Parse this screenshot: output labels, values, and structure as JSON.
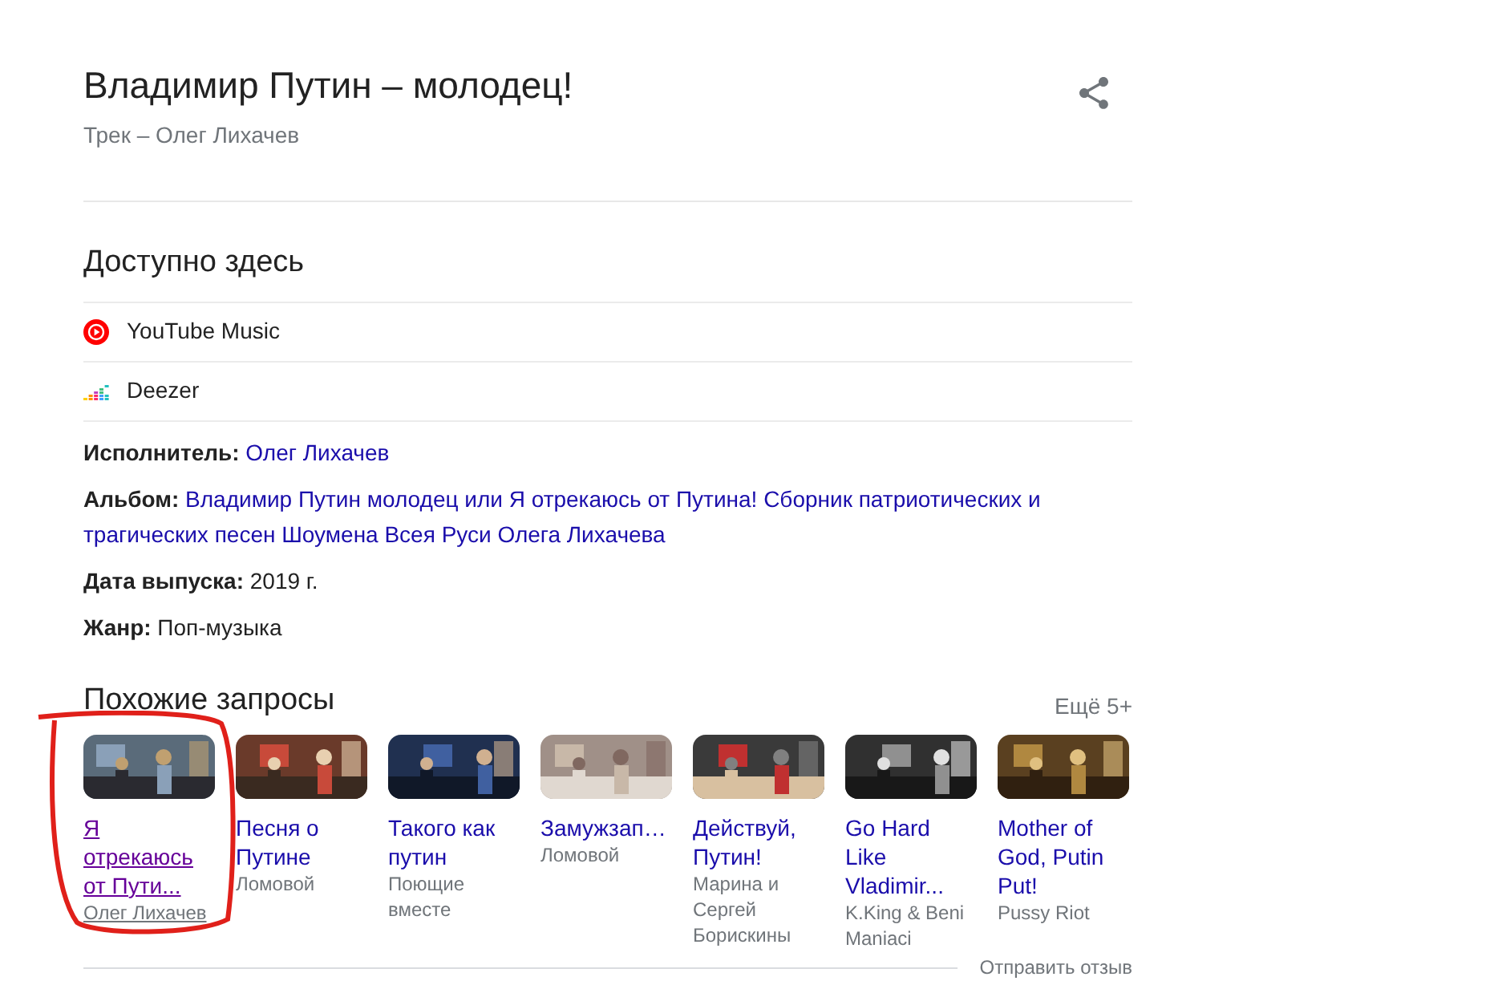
{
  "header": {
    "title": "Владимир Путин – молодец!",
    "subtitle": "Трек – Олег Лихачев"
  },
  "available": {
    "heading": "Доступно здесь",
    "services": [
      {
        "name": "YouTube Music",
        "kind": "youtube"
      },
      {
        "name": "Deezer",
        "kind": "deezer"
      }
    ]
  },
  "facts": [
    {
      "label": "Исполнитель:",
      "value": "Олег Лихачев",
      "kind": "link"
    },
    {
      "label": "Альбом:",
      "value": "Владимир Путин молодец или Я отрекаюсь от Путина! Сборник патриотических и трагических песен Шоумена Всея Руси Олега Лихачева",
      "kind": "link"
    },
    {
      "label": "Дата выпуска:",
      "value": "2019 г.",
      "kind": "plain"
    },
    {
      "label": "Жанр:",
      "value": "Поп-музыка",
      "kind": "plain"
    }
  ],
  "related": {
    "heading": "Похожие запросы",
    "more": "Ещё 5+",
    "items": [
      {
        "title": "Я отрекаюсь от Пути...",
        "subtitle": "Олег Лихачев",
        "highlighted": true
      },
      {
        "title": "Песня о Путине",
        "subtitle": "Ломовой",
        "highlighted": false
      },
      {
        "title": "Такого как путин",
        "subtitle": "Поющие вместе",
        "highlighted": false
      },
      {
        "title": "Замужзап…",
        "subtitle": "Ломовой",
        "highlighted": false
      },
      {
        "title": "Действуй, Путин!",
        "subtitle": "Марина и Сергей Борискины",
        "highlighted": false
      },
      {
        "title": "Go Hard Like Vladimir...",
        "subtitle": "K.King & Beni Maniaci",
        "highlighted": false
      },
      {
        "title": "Mother of God, Putin Put!",
        "subtitle": "Pussy Riot",
        "highlighted": false
      }
    ]
  },
  "feedback": "Отправить отзыв"
}
